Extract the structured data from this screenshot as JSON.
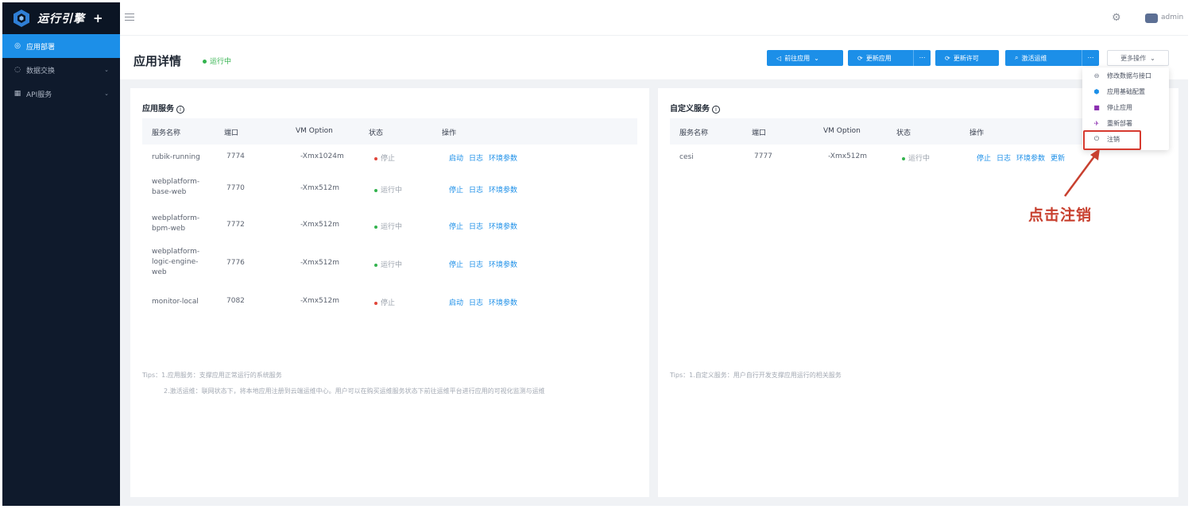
{
  "brand": {
    "title": "运行引擎",
    "plus": "+"
  },
  "sidebar": {
    "items": [
      {
        "icon": "◎",
        "label": "应用部署",
        "active": true
      },
      {
        "icon": "◌",
        "label": "数据交换",
        "caret": "⌄"
      },
      {
        "icon": "▦",
        "label": "API服务",
        "caret": "⌄"
      }
    ]
  },
  "header": {
    "user": "admin"
  },
  "page": {
    "title": "应用详情",
    "status": "运行中",
    "buttons": {
      "goto_app": "前往应用",
      "update_app": "更新应用",
      "update_license": "更新许可",
      "activate_ops": "激活运维",
      "more": "更多操作",
      "split": "⋯"
    }
  },
  "menu": {
    "items": [
      {
        "icon": "⊖",
        "label": "修改数据与接口",
        "color": "#6a7384"
      },
      {
        "icon": "⬢",
        "label": "应用基础配置",
        "color": "#1c8fe8"
      },
      {
        "icon": "■",
        "label": "停止应用",
        "color": "#8b2fb0"
      },
      {
        "icon": "✈",
        "label": "重新部署",
        "color": "#8b2fb0"
      },
      {
        "icon": "⏻",
        "label": "注销",
        "color": "#4a5160"
      }
    ]
  },
  "annotation": {
    "text": "点击注销"
  },
  "app_services": {
    "title": "应用服务",
    "columns": [
      "服务名称",
      "端口",
      "VM Option",
      "状态",
      "操作"
    ],
    "rows": [
      {
        "name": "rubik-running",
        "port": "7774",
        "vm": "-Xmx1024m",
        "status": "停止",
        "running": false,
        "ops": [
          "启动",
          "日志",
          "环境参数"
        ]
      },
      {
        "name": "webplatform-\nbase-web",
        "port": "7770",
        "vm": "-Xmx512m",
        "status": "运行中",
        "running": true,
        "ops": [
          "停止",
          "日志",
          "环境参数"
        ]
      },
      {
        "name": "webplatform-\nbpm-web",
        "port": "7772",
        "vm": "-Xmx512m",
        "status": "运行中",
        "running": true,
        "ops": [
          "停止",
          "日志",
          "环境参数"
        ]
      },
      {
        "name": "webplatform-\nlogic-engine-\nweb",
        "port": "7776",
        "vm": "-Xmx512m",
        "status": "运行中",
        "running": true,
        "ops": [
          "停止",
          "日志",
          "环境参数"
        ]
      },
      {
        "name": "monitor-local",
        "port": "7082",
        "vm": "-Xmx512m",
        "status": "停止",
        "running": false,
        "ops": [
          "启动",
          "日志",
          "环境参数"
        ]
      }
    ],
    "tips": [
      "Tips：1.应用服务：支撑应用正常运行的系统服务",
      "2.激活运维：联网状态下，将本地应用注册到云端运维中心。用户可以在购买运维服务状态下前往运维平台进行应用的可视化监测与运维"
    ]
  },
  "custom_services": {
    "title": "自定义服务",
    "columns": [
      "服务名称",
      "端口",
      "VM Option",
      "状态",
      "操作"
    ],
    "rows": [
      {
        "name": "cesi",
        "port": "7777",
        "vm": "-Xmx512m",
        "status": "运行中",
        "running": true,
        "ops": [
          "停止",
          "日志",
          "环境参数",
          "更新"
        ]
      }
    ],
    "tips": [
      "Tips：1.自定义服务：用户自行开发支撑应用运行的相关服务"
    ]
  },
  "colors": {
    "primary": "#1c8fe8",
    "sidebar": "#0f1a2c",
    "running": "#33b34e",
    "stopped": "#e0463a",
    "annotation": "#c8402f"
  }
}
